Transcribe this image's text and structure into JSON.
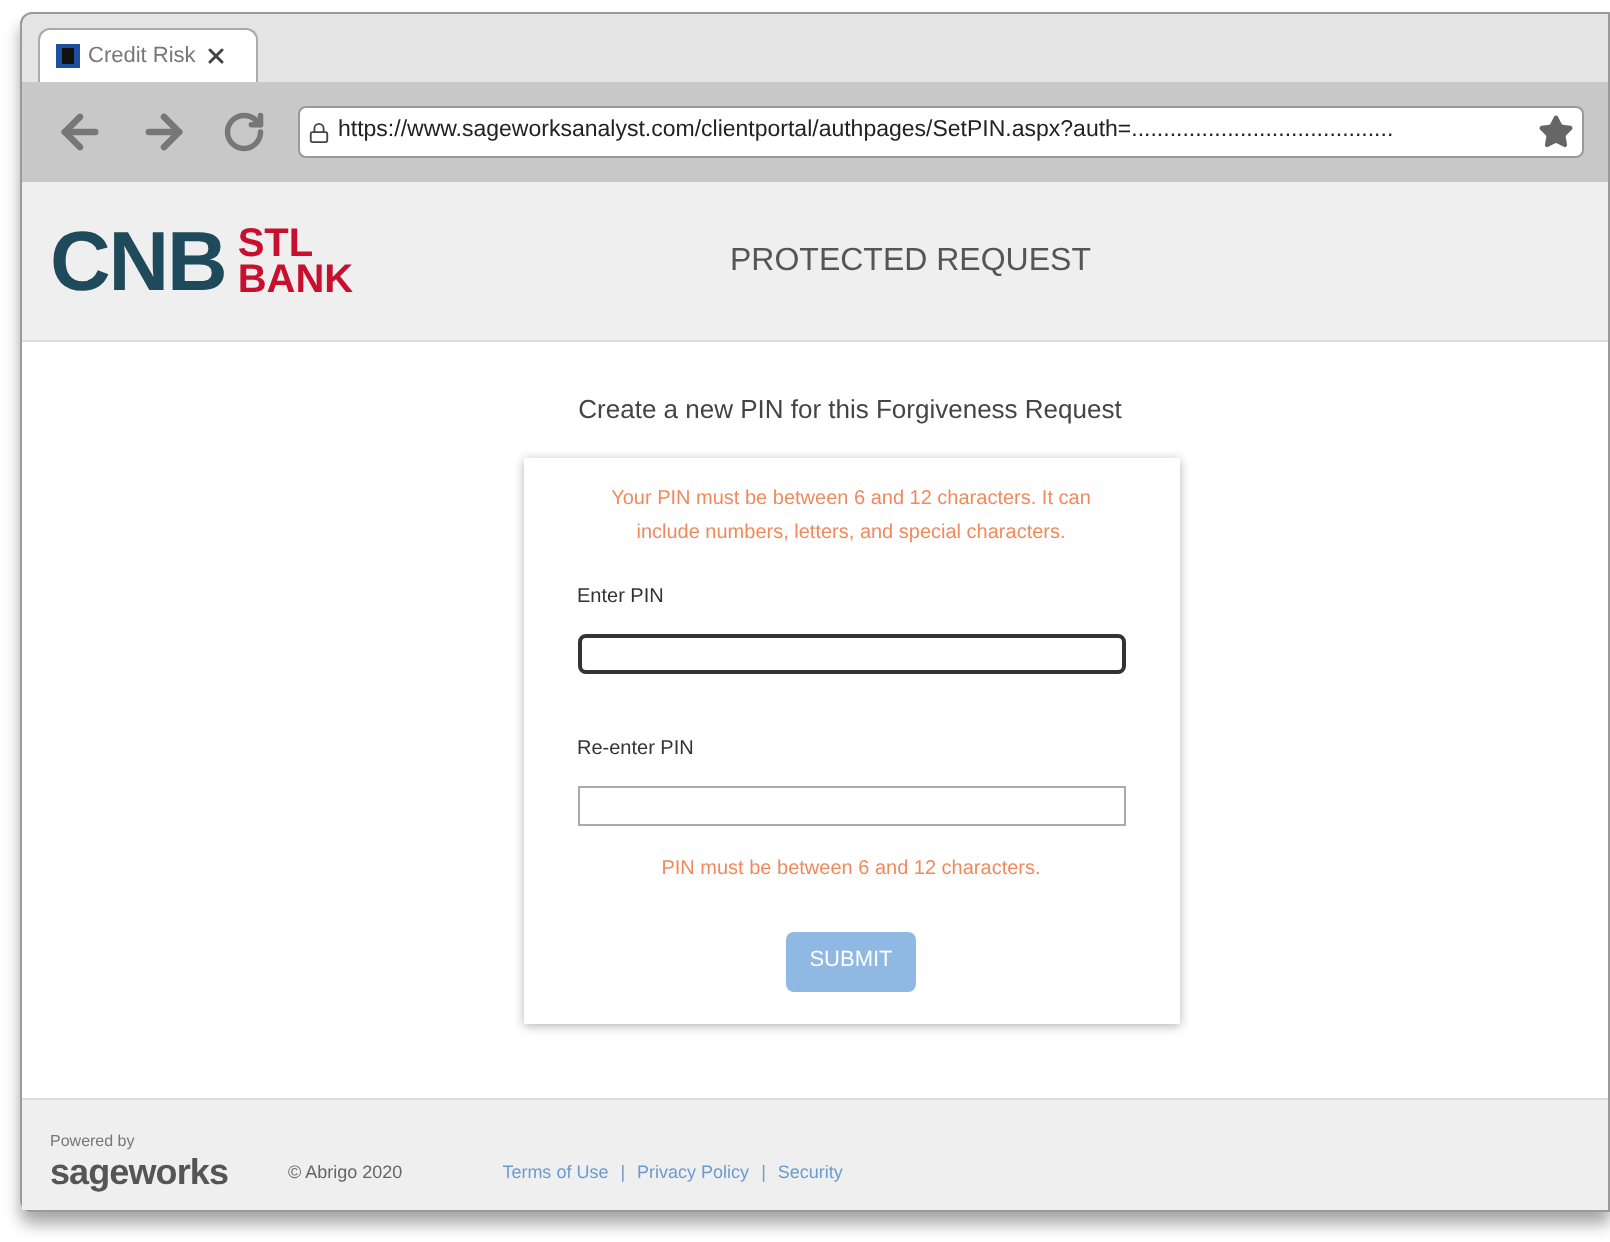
{
  "browser": {
    "tab": {
      "title": "Credit Risk",
      "selected": true
    },
    "url": "https://www.sageworksanalyst.com/clientportal/authpages/SetPIN.aspx?auth=........................................."
  },
  "header": {
    "logo": {
      "main": "CNB",
      "top": "STL",
      "bottom": "BANK"
    },
    "title": "PROTECTED REQUEST"
  },
  "form": {
    "heading": "Create a new PIN for this Forgiveness Request",
    "hint": "Your PIN must be between 6 and 12 characters. It can include numbers, letters, and special characters.",
    "fields": [
      {
        "label": "Enter PIN",
        "focused": true
      },
      {
        "label": "Re-enter PIN",
        "focused": false
      }
    ],
    "error": "PIN must be between 6 and 12 characters.",
    "submit": {
      "label": "SUBMIT",
      "disabled": true
    }
  },
  "footer": {
    "powered_by": "Powered by",
    "brand": "sageworks",
    "copyright": "© Abrigo 2020",
    "links": [
      "Terms of Use",
      "Privacy Policy",
      "Security"
    ],
    "separator": "|"
  }
}
